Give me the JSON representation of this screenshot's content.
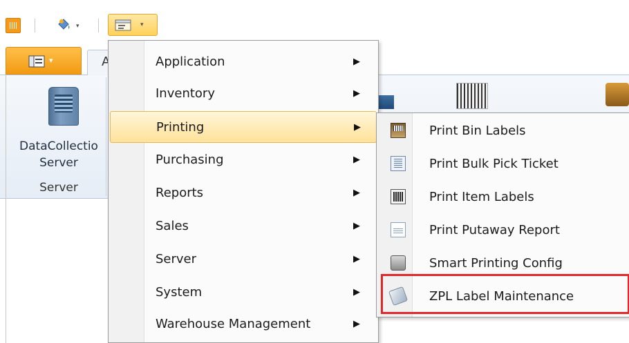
{
  "toolbar": {
    "app_icon": "barcode-app-icon",
    "paint_icon": "paint-bucket-icon",
    "menu_icon": "folder-menu-icon",
    "dropdown_glyph": "▾"
  },
  "ribbon": {
    "file_tab_glyph": "▾",
    "home_tab_partial": "A",
    "server_button": {
      "line1": "DataCollectio",
      "line2": "Server",
      "icon": "server-icon"
    },
    "group_label": "Server"
  },
  "menu": {
    "items": [
      {
        "label": "Application",
        "arrow": "▶"
      },
      {
        "label": "Inventory",
        "arrow": "▶"
      },
      {
        "label": "Printing",
        "arrow": "▶"
      },
      {
        "label": "Purchasing",
        "arrow": "▶"
      },
      {
        "label": "Reports",
        "arrow": "▶"
      },
      {
        "label": "Sales",
        "arrow": "▶"
      },
      {
        "label": "Server",
        "arrow": "▶"
      },
      {
        "label": "System",
        "arrow": "▶"
      },
      {
        "label": "Warehouse Management",
        "arrow": "▶"
      }
    ],
    "active_item": "Printing"
  },
  "submenu": {
    "items": [
      {
        "label": "Print Bin Labels",
        "icon": "bin-label-icon"
      },
      {
        "label": "Print Bulk Pick Ticket",
        "icon": "pick-ticket-icon"
      },
      {
        "label": "Print Item Labels",
        "icon": "item-label-icon"
      },
      {
        "label": "Print Putaway Report",
        "icon": "putaway-report-icon"
      },
      {
        "label": "Smart Printing Config",
        "icon": "printer-config-icon"
      },
      {
        "label": "ZPL Label Maintenance",
        "icon": "zpl-label-icon"
      }
    ],
    "highlighted_item": "ZPL Label Maintenance"
  },
  "colors": {
    "accent_orange": "#f29a12",
    "menu_highlight": "#ffe19a",
    "annotation_red": "#e3262a"
  }
}
